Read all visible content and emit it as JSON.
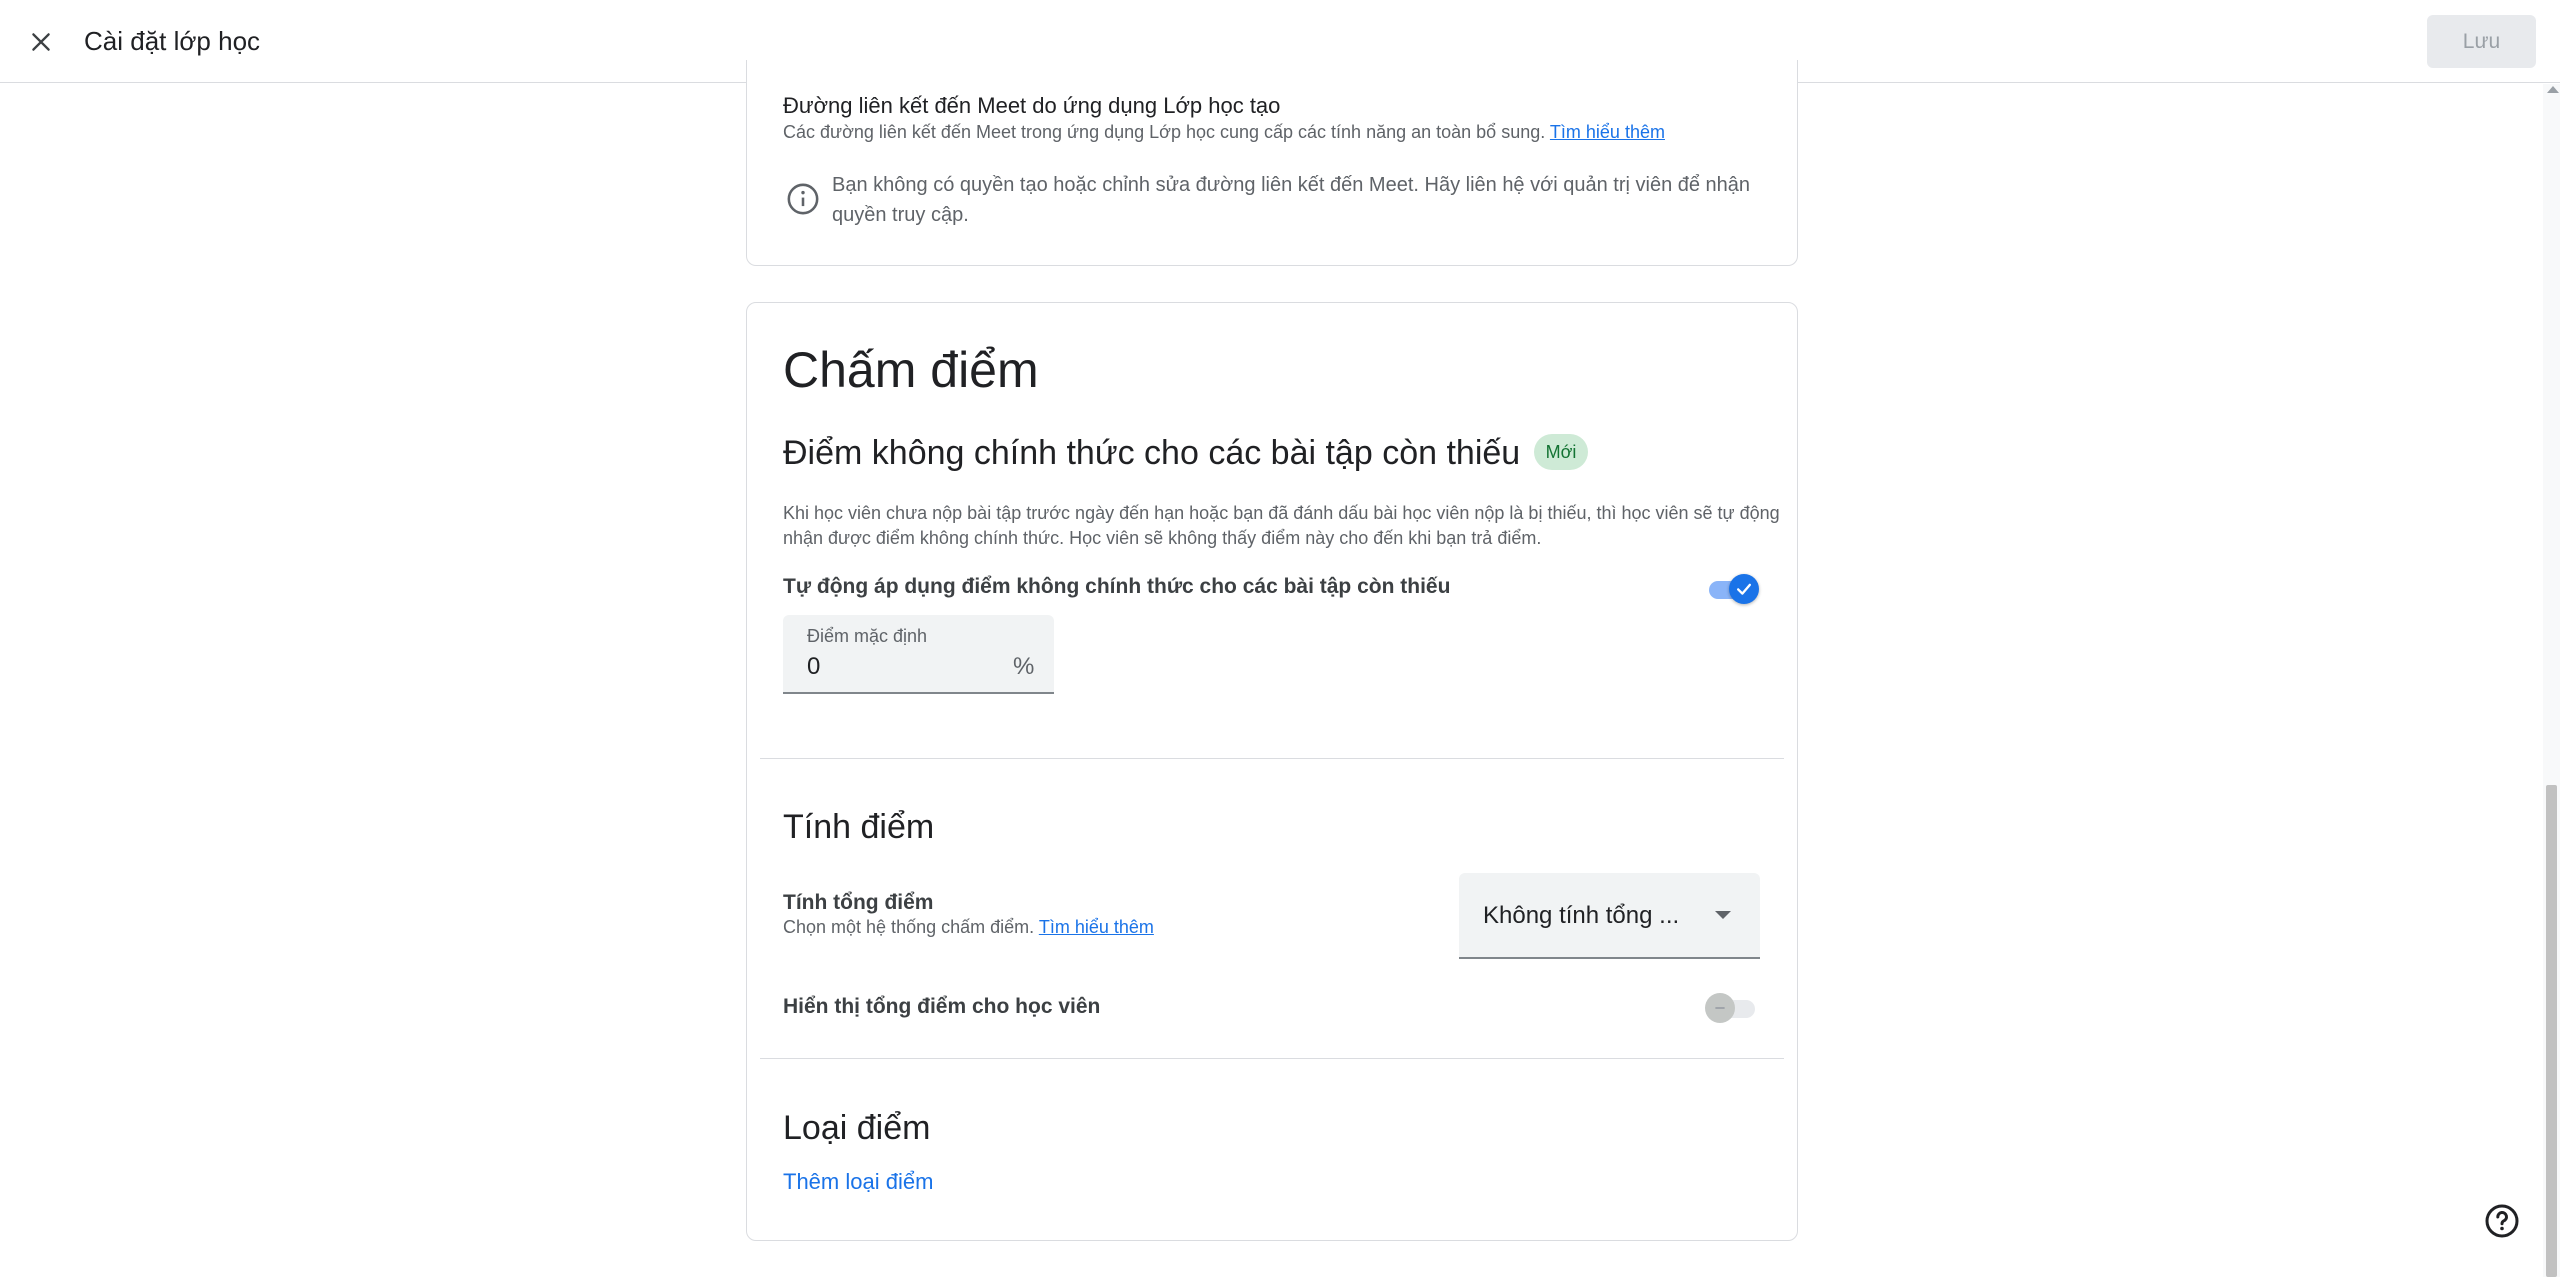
{
  "header": {
    "title": "Cài đặt lớp học",
    "save_label": "Lưu"
  },
  "meet": {
    "title": "Đường liên kết đến Meet do ứng dụng Lớp học tạo",
    "description": "Các đường liên kết đến Meet trong ứng dụng Lớp học cung cấp các tính năng an toàn bổ sung.",
    "learn_more": "Tìm hiểu thêm",
    "info": "Bạn không có quyền tạo hoặc chỉnh sửa đường liên kết đến Meet. Hãy liên hệ với quản trị viên để nhận quyền truy cập."
  },
  "grading": {
    "title": "Chấm điểm",
    "draft": {
      "title": "Điểm không chính thức cho các bài tập còn thiếu",
      "badge": "Mới",
      "description": "Khi học viên chưa nộp bài tập trước ngày đến hạn hoặc bạn đã đánh dấu bài học viên nộp là bị thiếu, thì học viên sẽ tự động nhận được điểm không chính thức. Học viên sẽ không thấy điểm này cho đến khi bạn trả điểm.",
      "auto_apply_label": "Tự động áp dụng điểm không chính thức cho các bài tập còn thiếu",
      "auto_apply_enabled": true,
      "default_grade_label": "Điểm mặc định",
      "default_grade_value": "0",
      "default_grade_suffix": "%"
    },
    "calculation": {
      "title": "Tính điểm",
      "overall_label": "Tính tổng điểm",
      "overall_desc": "Chọn một hệ thống chấm điểm.",
      "learn_more": "Tìm hiểu thêm",
      "dropdown_value": "Không tính tổng ...",
      "show_overall_label": "Hiển thị tổng điểm cho học viên",
      "show_overall_enabled": false
    },
    "categories": {
      "title": "Loại điểm",
      "add_label": "Thêm loại điểm"
    }
  },
  "colors": {
    "accent": "#1a73e8",
    "badge_bg": "#ceead6",
    "badge_text": "#137333"
  },
  "icons": [
    "close-icon",
    "info-icon",
    "check-icon",
    "dropdown-arrow-icon",
    "help-icon"
  ]
}
